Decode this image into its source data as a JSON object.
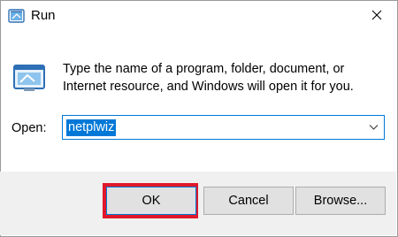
{
  "window": {
    "title": "Run",
    "close_icon": "close-icon",
    "app_icon": "run-icon"
  },
  "message": {
    "line1": "Type the name of a program, folder, document, or",
    "line2": "Internet resource, and Windows will open it for you."
  },
  "open": {
    "label": "Open:",
    "value": "netplwiz"
  },
  "buttons": {
    "ok": "OK",
    "cancel": "Cancel",
    "browse": "Browse..."
  },
  "colors": {
    "accent": "#0078d7",
    "highlight_box": "#e0192a",
    "footer_bg": "#f0f0f0"
  }
}
